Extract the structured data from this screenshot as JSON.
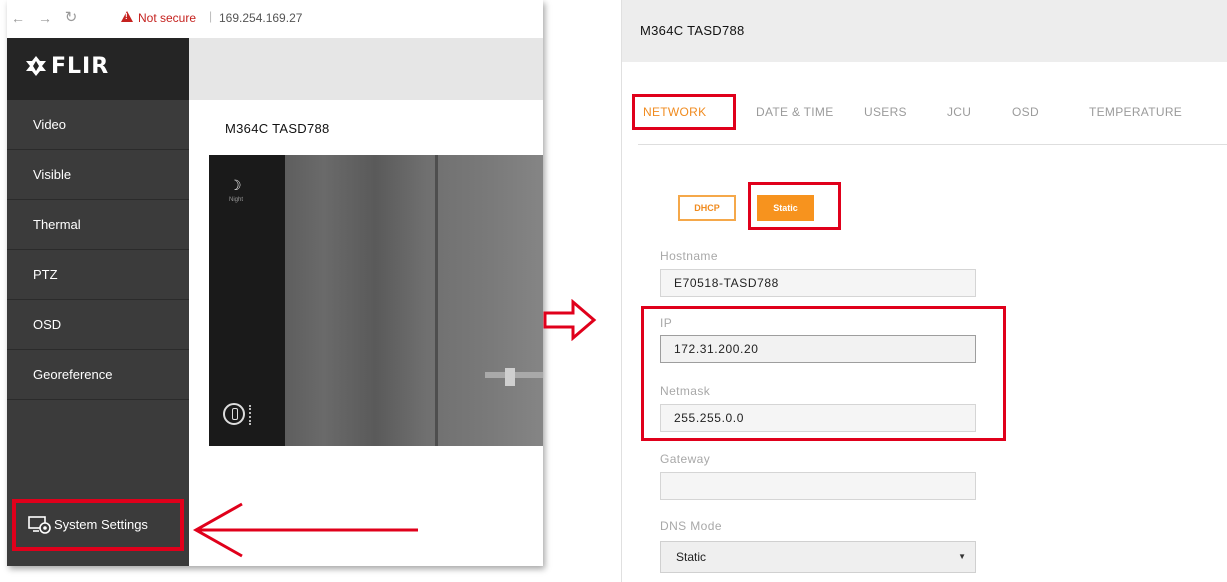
{
  "browser": {
    "security_label": "Not secure",
    "separator": "|",
    "url": "169.254.169.27"
  },
  "app": {
    "logo_text": "FLIR",
    "camera_title": "M364C TASD788",
    "overlay_night": "Night"
  },
  "sidebar": {
    "items": [
      {
        "label": "Video"
      },
      {
        "label": "Visible"
      },
      {
        "label": "Thermal"
      },
      {
        "label": "PTZ"
      },
      {
        "label": "OSD"
      },
      {
        "label": "Georeference"
      }
    ],
    "system_settings": "System Settings"
  },
  "settings": {
    "title": "M364C TASD788",
    "tabs": [
      {
        "label": "NETWORK",
        "active": true
      },
      {
        "label": "DATE & TIME"
      },
      {
        "label": "USERS"
      },
      {
        "label": "JCU"
      },
      {
        "label": "OSD"
      },
      {
        "label": "TEMPERATURE"
      }
    ],
    "mode_buttons": {
      "dhcp": "DHCP",
      "static": "Static",
      "selected": "Static"
    },
    "fields": {
      "hostname": {
        "label": "Hostname",
        "value": "E70518-TASD788"
      },
      "ip": {
        "label": "IP",
        "value": "172.31.200.20"
      },
      "netmask": {
        "label": "Netmask",
        "value": "255.255.0.0"
      },
      "gateway": {
        "label": "Gateway",
        "value": ""
      },
      "dns_mode": {
        "label": "DNS Mode",
        "value": "Static"
      }
    }
  },
  "colors": {
    "accent": "#f7931e",
    "highlight_red": "#e0001b",
    "sidebar_bg": "#3b3b3b",
    "logo_bg": "#252525"
  }
}
